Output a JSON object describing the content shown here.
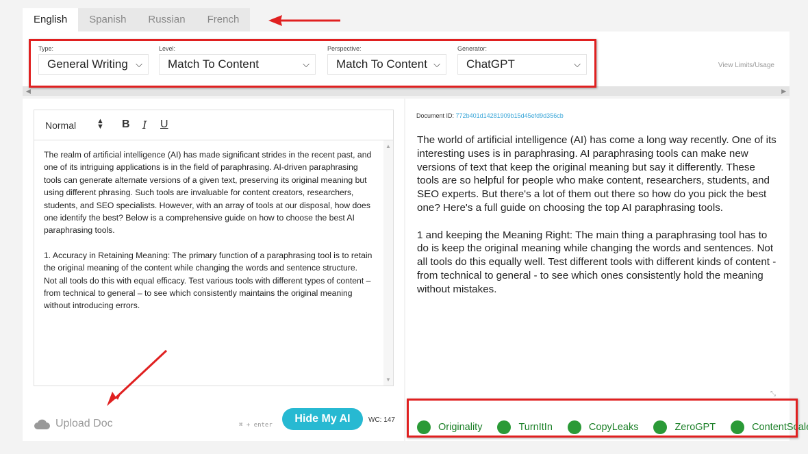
{
  "tabs": [
    "English",
    "Spanish",
    "Russian",
    "French"
  ],
  "active_tab": "English",
  "settings": {
    "type_label": "Type:",
    "type_value": "General Writing",
    "level_label": "Level:",
    "level_value": "Match To Content",
    "perspective_label": "Perspective:",
    "perspective_value": "Match To Content",
    "generator_label": "Generator:",
    "generator_value": "ChatGPT",
    "view_limits": "View Limits/Usage"
  },
  "editor": {
    "format": "Normal",
    "bold": "B",
    "italic": "I",
    "underline": "U",
    "paragraphs": [
      "The realm of artificial intelligence (AI) has made significant strides in the recent past, and one of its intriguing applications is in the field of paraphrasing. AI-driven paraphrasing tools can generate alternate versions of a given text, preserving its original meaning but using different phrasing. Such tools are invaluable for content creators, researchers, students, and SEO specialists. However, with an array of tools at our disposal, how does one identify the best? Below is a comprehensive guide on how to choose the best AI paraphrasing tools.",
      "1. Accuracy in Retaining Meaning: The primary function of a paraphrasing tool is to retain the original meaning of the content while changing the words and sentence structure. Not all tools do this with equal efficacy. Test various tools with different types of content – from technical to general – to see which consistently maintains the original meaning without introducing errors."
    ],
    "upload_label": "Upload Doc",
    "shortcut": "⌘ + enter",
    "hide_button": "Hide My AI",
    "word_count": "WC: 147"
  },
  "output": {
    "docid_label": "Document ID:",
    "docid_value": "772b401d14281909b15d45efd9d356cb",
    "paragraphs": [
      "The world of artificial intelligence (AI) has come a long way recently.  One of its interesting uses is in paraphrasing.  AI paraphrasing tools can make new versions of text that keep the original meaning but say it differently. These tools are so helpful for people who make content, researchers, students, and SEO experts.  But there's a lot of them out there so how do you pick the best one? Here's a full guide on choosing the top AI paraphrasing tools.",
      "1 and  keeping the Meaning Right: The main thing a paraphrasing tool has to do is keep the original meaning while changing the words and sentences.  Not all tools do this equally well.  Test different tools with different kinds of content - from technical to general - to see which ones consistently hold the meaning without mistakes."
    ],
    "detectors": [
      "Originality",
      "TurnItIn",
      "CopyLeaks",
      "ZeroGPT",
      "ContentScale"
    ]
  },
  "colors": {
    "accent": "#27b9d2",
    "detector_green": "#2b9a37",
    "annotation_red": "#e02020"
  },
  "icons": [
    "cloud-upload-icon",
    "updown-icon",
    "scroll-left-icon",
    "scroll-right-icon",
    "resize-handle-icon"
  ]
}
